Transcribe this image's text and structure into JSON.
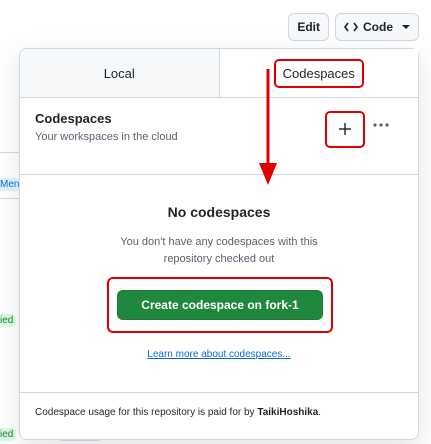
{
  "header": {
    "edit_label": "Edit",
    "code_label": "Code"
  },
  "tabs": [
    {
      "label": "Local",
      "active": false
    },
    {
      "label": "Codespaces",
      "active": true
    }
  ],
  "codespaces": {
    "title": "Codespaces",
    "subtitle": "Your workspaces in the cloud",
    "add_icon": "plus-icon",
    "more_icon": "kebab-horizontal-icon",
    "empty_title": "No codespaces",
    "empty_desc": "You don't have any codespaces with this repository checked out",
    "create_label": "Create codespace on fork-1",
    "learn_more": "Learn more about codespaces...",
    "footer_prefix": "Codespace usage for this repository is paid for by",
    "footer_owner": "TaikiHoshika",
    "footer_suffix": "."
  },
  "background": {
    "chip_men": "Men",
    "chip_1": "ied",
    "chip_2": "ied"
  },
  "colors": {
    "accent_green": "#1f883d",
    "link_blue": "#0969da",
    "annotation_red": "#e00000"
  }
}
